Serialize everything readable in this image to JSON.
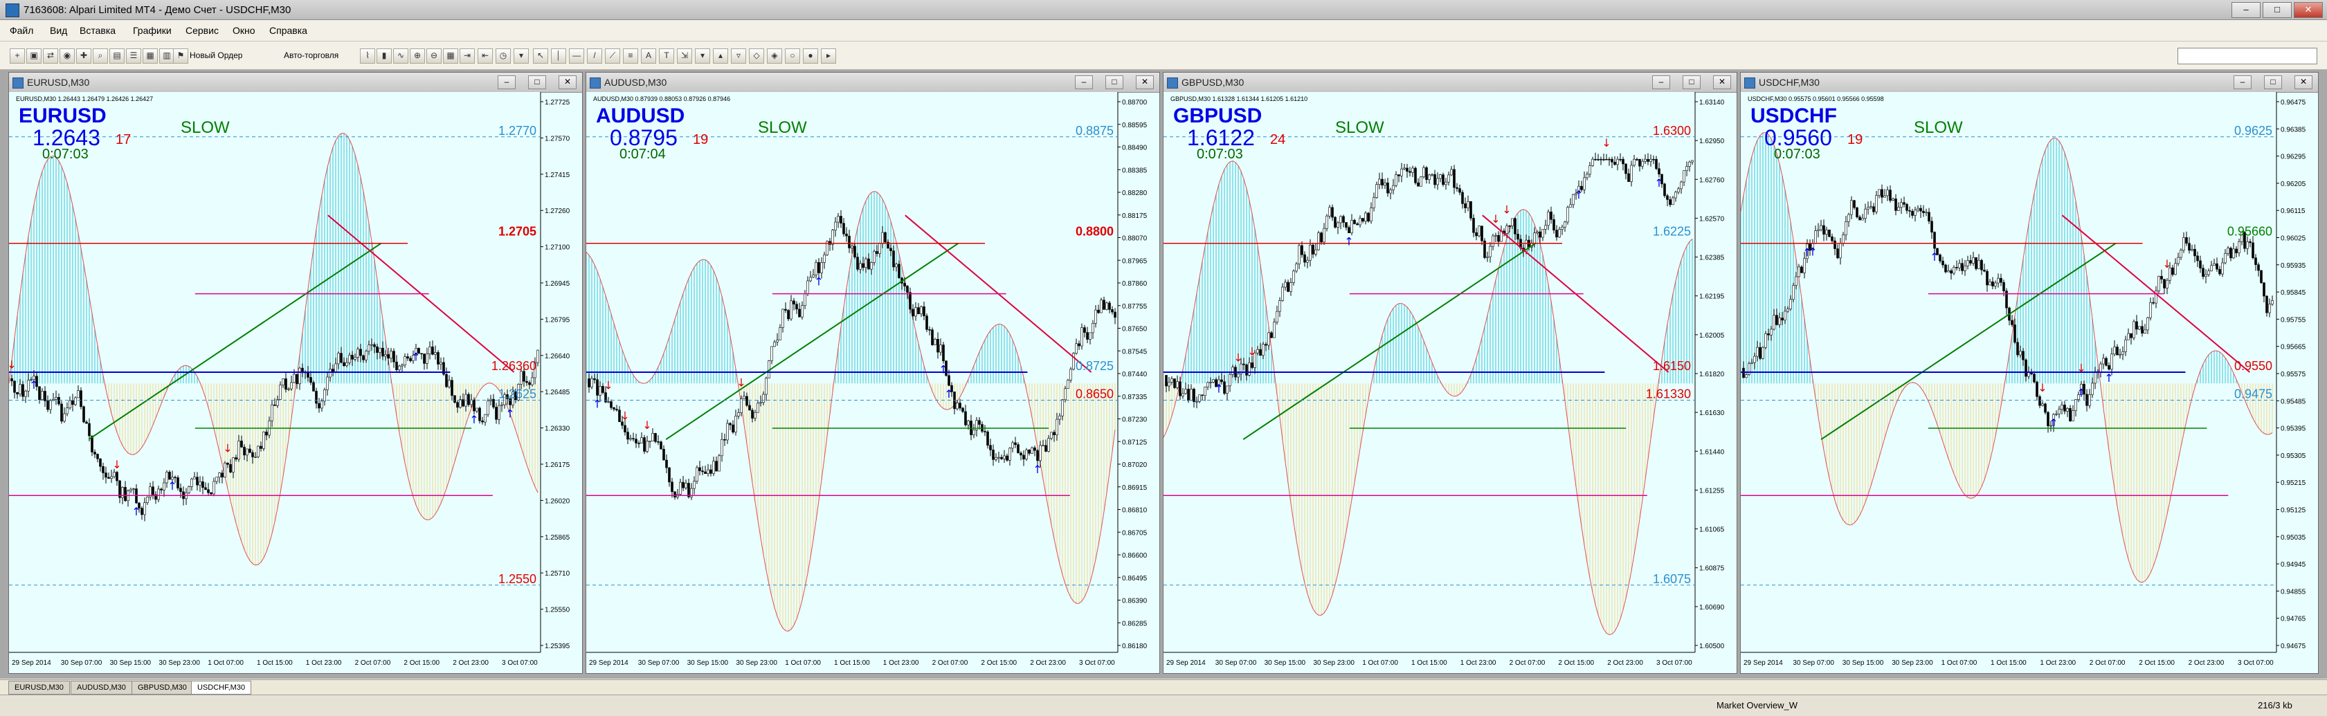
{
  "window": {
    "title": "7163608: Alpari Limited MT4 - Демо Счет - USDCHF,M30"
  },
  "menu": [
    "Файл",
    "Вид",
    "Вставка",
    "Графики",
    "Сервис",
    "Окно",
    "Справка"
  ],
  "toolbar": {
    "new_order": "Новый Ордер",
    "auto_trading": "Авто-торговля"
  },
  "charts": [
    {
      "id": "eurusd",
      "title": "EURUSD,M30",
      "info": "EURUSD,M30 1.26443 1.26479 1.26426 1.26427",
      "symbol": "EURUSD",
      "price": "1.2643",
      "pips": "17",
      "timer": "0:07:03",
      "slow": "SLOW",
      "axis": [
        "1.27725",
        "1.27570",
        "1.27415",
        "1.27260",
        "1.27100",
        "1.26945",
        "1.26795",
        "1.26640",
        "1.26485",
        "1.26330",
        "1.26175",
        "1.26020",
        "1.25865",
        "1.25710",
        "1.25550",
        "1.25395"
      ],
      "levels": [
        {
          "text": "1.2770",
          "color": "#2a8fd0"
        },
        {
          "text": "1.2705",
          "color": "#e00000"
        },
        {
          "text": "1.26360",
          "color": "#e00000"
        },
        {
          "text": "1.2625",
          "color": "#2a8fd0"
        },
        {
          "text": "1.2550",
          "color": "#e00000"
        }
      ],
      "dates": [
        "29 Sep 2014",
        "30 Sep 07:00",
        "30 Sep 15:00",
        "30 Sep 23:00",
        "1 Oct 07:00",
        "1 Oct 15:00",
        "1 Oct 23:00",
        "2 Oct 07:00",
        "2 Oct 15:00",
        "2 Oct 23:00",
        "3 Oct 07:00"
      ]
    },
    {
      "id": "audusd",
      "title": "AUDUSD,M30",
      "info": "AUDUSD,M30 0.87939 0.88053 0.87926 0.87946",
      "symbol": "AUDUSD",
      "price": "0.8795",
      "pips": "19",
      "timer": "0:07:04",
      "slow": "SLOW",
      "axis": [
        "0.88700",
        "0.88595",
        "0.88490",
        "0.88385",
        "0.88280",
        "0.88175",
        "0.88070",
        "0.87965",
        "0.87860",
        "0.87755",
        "0.87650",
        "0.87545",
        "0.87440",
        "0.87335",
        "0.87230",
        "0.87125",
        "0.87020",
        "0.86915",
        "0.86810",
        "0.86705",
        "0.86600",
        "0.86495",
        "0.86390",
        "0.86285",
        "0.86180"
      ],
      "levels": [
        {
          "text": "0.8875",
          "color": "#2a8fd0"
        },
        {
          "text": "0.8800",
          "color": "#e00000"
        },
        {
          "text": "0.8725",
          "color": "#2a8fd0"
        },
        {
          "text": "0.8650",
          "color": "#e00000"
        }
      ],
      "dates": [
        "29 Sep 2014",
        "30 Sep 07:00",
        "30 Sep 15:00",
        "30 Sep 23:00",
        "1 Oct 07:00",
        "1 Oct 15:00",
        "1 Oct 23:00",
        "2 Oct 07:00",
        "2 Oct 15:00",
        "2 Oct 23:00",
        "3 Oct 07:00"
      ]
    },
    {
      "id": "gbpusd",
      "title": "GBPUSD,M30",
      "info": "GBPUSD,M30 1.61328 1.61344 1.61205 1.61210",
      "symbol": "GBPUSD",
      "price": "1.6122",
      "pips": "24",
      "timer": "0:07:03",
      "slow": "SLOW",
      "axis": [
        "1.63140",
        "1.62950",
        "1.62760",
        "1.62570",
        "1.62385",
        "1.62195",
        "1.62005",
        "1.61820",
        "1.61630",
        "1.61440",
        "1.61255",
        "1.61065",
        "1.60875",
        "1.60690",
        "1.60500"
      ],
      "levels": [
        {
          "text": "1.6300",
          "color": "#e00000"
        },
        {
          "text": "1.6225",
          "color": "#2a8fd0"
        },
        {
          "text": "1.6150",
          "color": "#e00000"
        },
        {
          "text": "1.61330",
          "color": "#e00000"
        },
        {
          "text": "1.6075",
          "color": "#2a8fd0"
        }
      ],
      "dates": [
        "29 Sep 2014",
        "30 Sep 07:00",
        "30 Sep 15:00",
        "30 Sep 23:00",
        "1 Oct 07:00",
        "1 Oct 15:00",
        "1 Oct 23:00",
        "2 Oct 07:00",
        "2 Oct 15:00",
        "2 Oct 23:00",
        "3 Oct 07:00"
      ]
    },
    {
      "id": "usdchf",
      "title": "USDCHF,M30",
      "info": "USDCHF,M30 0.95575 0.95601 0.95566 0.95598",
      "symbol": "USDCHF",
      "price": "0.9560",
      "pips": "19",
      "timer": "0:07:03",
      "slow": "SLOW",
      "axis": [
        "0.96475",
        "0.96385",
        "0.96295",
        "0.96205",
        "0.96115",
        "0.96025",
        "0.95935",
        "0.95845",
        "0.95755",
        "0.95665",
        "0.95575",
        "0.95485",
        "0.95395",
        "0.95305",
        "0.95215",
        "0.95125",
        "0.95035",
        "0.94945",
        "0.94855",
        "0.94765",
        "0.94675"
      ],
      "levels": [
        {
          "text": "0.9625",
          "color": "#2a8fd0"
        },
        {
          "text": "0.95660",
          "color": "#008000"
        },
        {
          "text": "0.9550",
          "color": "#e00000"
        },
        {
          "text": "0.9475",
          "color": "#2a8fd0"
        }
      ],
      "dates": [
        "29 Sep 2014",
        "30 Sep 07:00",
        "30 Sep 15:00",
        "30 Sep 23:00",
        "1 Oct 07:00",
        "1 Oct 15:00",
        "1 Oct 23:00",
        "2 Oct 07:00",
        "2 Oct 15:00",
        "2 Oct 23:00",
        "3 Oct 07:00"
      ]
    }
  ],
  "tabs": [
    "EURUSD,M30",
    "AUDUSD,M30",
    "GBPUSD,M30",
    "USDCHF,M30"
  ],
  "status": {
    "market": "Market Overview_W",
    "traffic": "216/3 kb"
  },
  "colors": {
    "background": "#e9ffff",
    "bull_histogram": "#5fd3e0",
    "bear_histogram": "#f3dfa3",
    "accent_red": "#e00000",
    "accent_green": "#008000"
  }
}
